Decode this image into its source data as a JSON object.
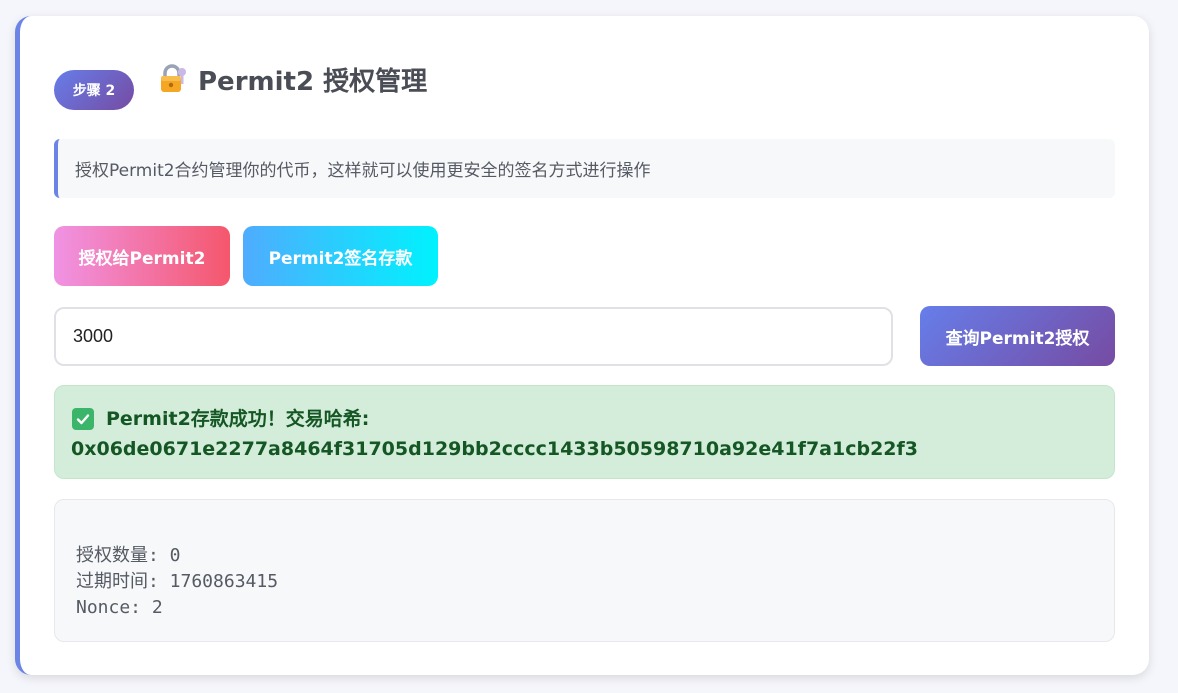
{
  "header": {
    "step_badge": "步骤 2",
    "title": "Permit2 授权管理",
    "title_icon": "lock-icon"
  },
  "info": {
    "text": "授权Permit2合约管理你的代币，这样就可以使用更安全的签名方式进行操作"
  },
  "buttons": {
    "approve_label": "授权给Permit2",
    "deposit_label": "Permit2签名存款",
    "query_label": "查询Permit2授权"
  },
  "amount_input": {
    "value": "3000"
  },
  "success": {
    "icon": "check-icon",
    "message": "Permit2存款成功！交易哈希:",
    "tx_hash": "0x06de0671e2277a8464f31705d129bb2cccc1433b50598710a92e41f7a1cb22f3"
  },
  "result": {
    "lines": [
      "授权数量: 0",
      "过期时间: 1760863415",
      "Nonce: 2"
    ]
  },
  "colors": {
    "accent": "#6b84e6",
    "success_bg": "#d4edda",
    "success_text": "#155724"
  }
}
